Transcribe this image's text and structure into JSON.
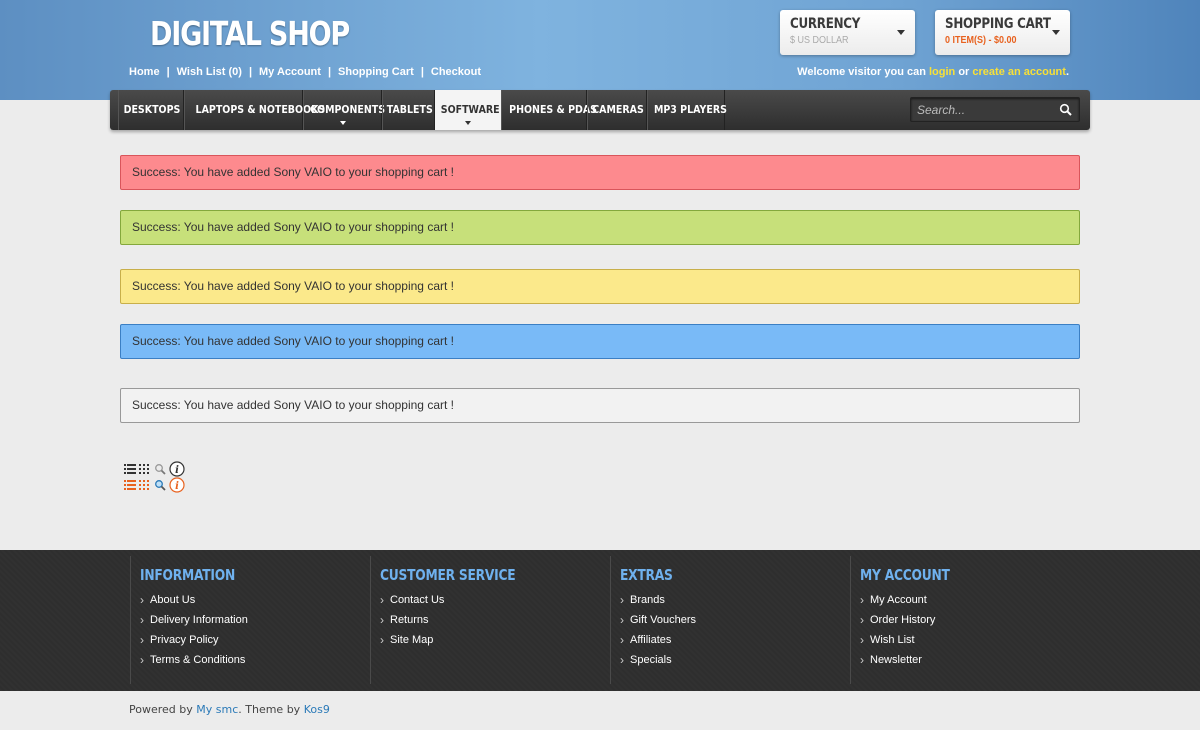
{
  "header": {
    "logo": "DIGITAL SHOP",
    "top_links": [
      "Home",
      "Wish List (0)",
      "My Account",
      "Shopping Cart",
      "Checkout"
    ],
    "welcome_prefix": "Welcome visitor you can ",
    "login_label": "login",
    "or_text": " or ",
    "create_account_label": "create an account",
    "welcome_suffix": "."
  },
  "currency": {
    "title": "CURRENCY",
    "value": "$ US DOLLAR"
  },
  "cart": {
    "title": "SHOPPING CART",
    "summary": "0 ITEM(S) - $0.00"
  },
  "nav": {
    "items": [
      {
        "label": "DESKTOPS"
      },
      {
        "label": "LAPTOPS & NOTEBOOKS"
      },
      {
        "label": "COMPONENTS"
      },
      {
        "label": "TABLETS"
      },
      {
        "label": "SOFTWARE"
      },
      {
        "label": "PHONES & PDAS"
      },
      {
        "label": "CAMERAS"
      },
      {
        "label": "MP3 PLAYERS"
      }
    ],
    "search_placeholder": "Search..."
  },
  "alerts": [
    {
      "variant": "red",
      "text": "Success: You have added Sony VAIO to your shopping cart !"
    },
    {
      "variant": "green",
      "text": "Success: You have added Sony VAIO to your shopping cart !"
    },
    {
      "variant": "yellow",
      "text": "Success: You have added Sony VAIO to your shopping cart !"
    },
    {
      "variant": "blue",
      "text": "Success: You have added Sony VAIO to your shopping cart !"
    },
    {
      "variant": "gray",
      "text": "Success: You have added Sony VAIO to your shopping cart !"
    }
  ],
  "view_icons": [
    "list-view-icon",
    "grid-view-icon",
    "zoom-icon",
    "info-icon"
  ],
  "footer": {
    "columns": [
      {
        "title": "INFORMATION",
        "links": [
          "About Us",
          "Delivery Information",
          "Privacy Policy",
          "Terms & Conditions"
        ]
      },
      {
        "title": "CUSTOMER SERVICE",
        "links": [
          "Contact Us",
          "Returns",
          "Site Map"
        ]
      },
      {
        "title": "EXTRAS",
        "links": [
          "Brands",
          "Gift Vouchers",
          "Affiliates",
          "Specials"
        ]
      },
      {
        "title": "MY ACCOUNT",
        "links": [
          "My Account",
          "Order History",
          "Wish List",
          "Newsletter"
        ]
      }
    ],
    "powered_prefix": "Powered by ",
    "powered_link": "My smc",
    "theme_text": ". Theme by ",
    "theme_link": "Kos9"
  },
  "colors": {
    "accent_orange": "#e8621f",
    "link_yellow": "#f7e038",
    "footer_heading": "#6fb1ee"
  }
}
